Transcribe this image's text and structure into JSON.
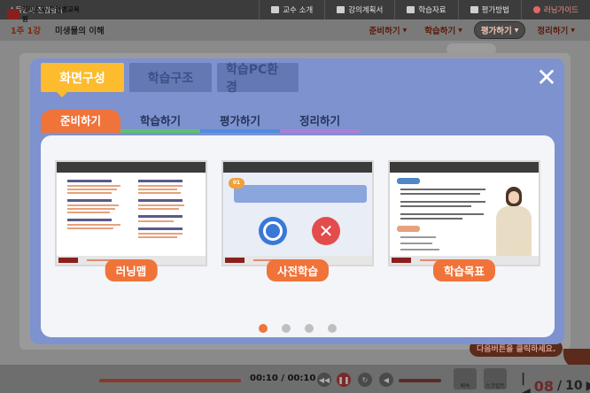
{
  "topbar": {
    "course": "소득법과 전염병학",
    "nav": [
      {
        "label": "교수 소개",
        "icon": "person-icon"
      },
      {
        "label": "강의계획서",
        "icon": "document-icon"
      },
      {
        "label": "학습자료",
        "icon": "download-icon"
      },
      {
        "label": "평가방법",
        "icon": "grid-icon"
      },
      {
        "label": "러닝가이드",
        "icon": "guide-icon"
      }
    ]
  },
  "subbar": {
    "week": "1주 1강",
    "title": "미생물의 이해",
    "steps": [
      "준비하기",
      "학습하기",
      "평가하기",
      "정리하기"
    ]
  },
  "modal": {
    "tabs": [
      "화면구성",
      "학습구조",
      "학습PC환경"
    ],
    "close": "✕",
    "subtabs": [
      "준비하기",
      "학습하기",
      "평가하기",
      "정리하기"
    ],
    "cards": [
      {
        "label": "러닝맵"
      },
      {
        "label": "사전학습",
        "qnum": "01"
      },
      {
        "label": "학습목표"
      }
    ],
    "pages": 4,
    "current_page": 1
  },
  "bottombar": {
    "logo": "케이스윗/전염병교육원",
    "time_current": "00:10",
    "time_total": "00:10",
    "progress": 1.0,
    "hint": "다음버튼을 클릭하세요.",
    "page_current": "08",
    "page_total": "10",
    "buttons": [
      "배속",
      "스크립트"
    ]
  },
  "colors": {
    "accent_orange": "#f0733a",
    "tab_yellow": "#fdbb2e",
    "modal_blue": "#7d92cf"
  }
}
